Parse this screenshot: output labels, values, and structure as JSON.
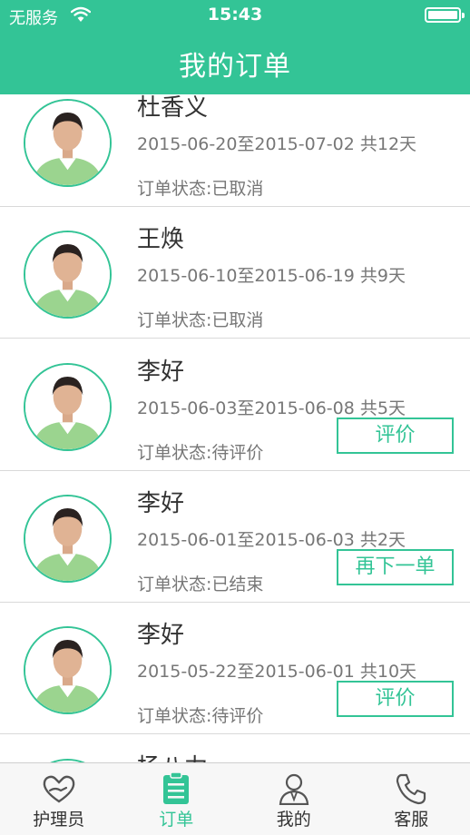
{
  "status_bar": {
    "carrier": "无服务",
    "time": "15:43"
  },
  "nav": {
    "title": "我的订单"
  },
  "orders": [
    {
      "name": "杜香义",
      "dates": "2015-06-20至2015-07-02 共12天",
      "status": "订单状态:已取消",
      "action": ""
    },
    {
      "name": "王焕",
      "dates": "2015-06-10至2015-06-19 共9天",
      "status": "订单状态:已取消",
      "action": ""
    },
    {
      "name": "李好",
      "dates": "2015-06-03至2015-06-08 共5天",
      "status": "订单状态:待评价",
      "action": "评价"
    },
    {
      "name": "李好",
      "dates": "2015-06-01至2015-06-03 共2天",
      "status": "订单状态:已结束",
      "action": "再下一单"
    },
    {
      "name": "李好",
      "dates": "2015-05-22至2015-06-01 共10天",
      "status": "订单状态:待评价",
      "action": "评价"
    },
    {
      "name": "杨八力",
      "dates": "",
      "status": "",
      "action": ""
    }
  ],
  "tabbar": {
    "items": [
      {
        "label": "护理员",
        "icon": "heart-hand-icon"
      },
      {
        "label": "订单",
        "icon": "clipboard-icon"
      },
      {
        "label": "我的",
        "icon": "user-icon"
      },
      {
        "label": "客服",
        "icon": "phone-icon"
      }
    ],
    "active_index": 1
  },
  "colors": {
    "accent": "#33c496",
    "text_dark": "#333333",
    "text_gray": "#777777"
  }
}
